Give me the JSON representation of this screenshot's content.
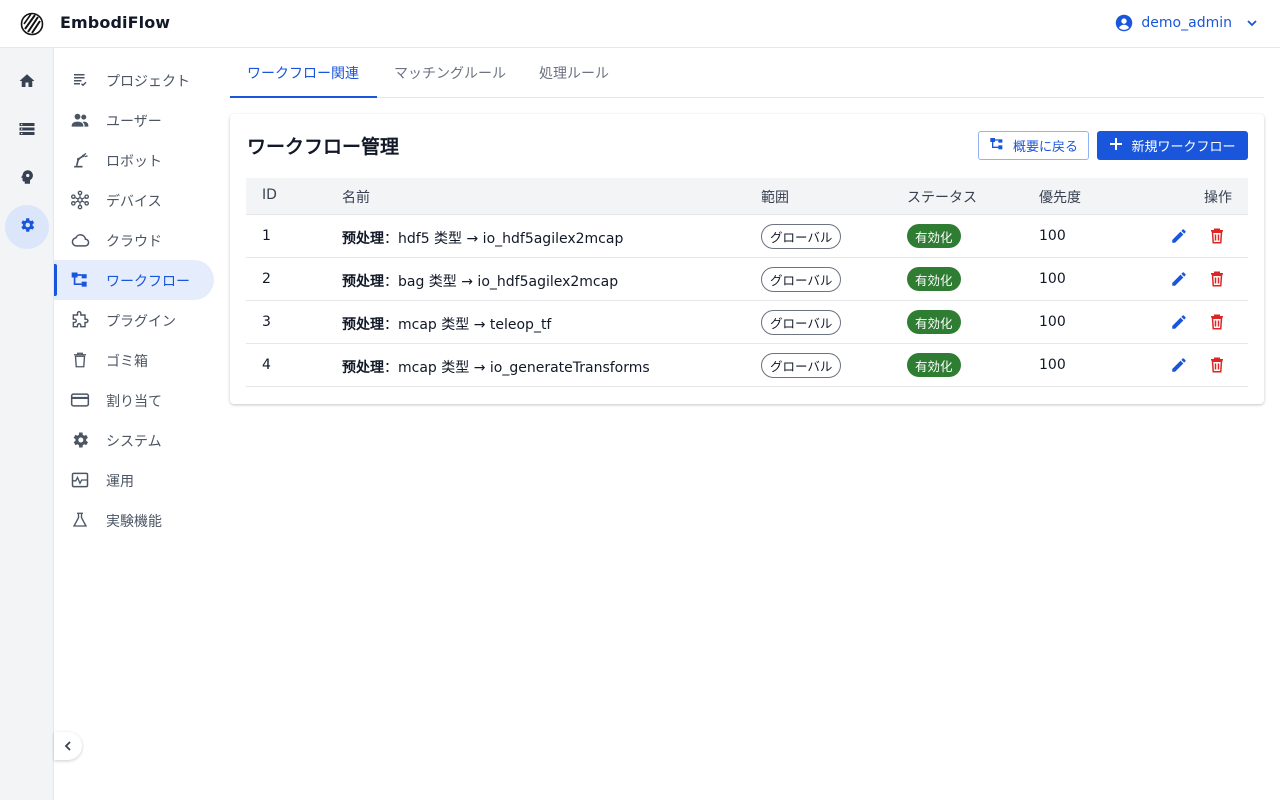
{
  "app": {
    "title": "EmbodiFlow"
  },
  "user": {
    "name": "demo_admin"
  },
  "rail": [
    {
      "icon": "home-icon",
      "active": false
    },
    {
      "icon": "storage-icon",
      "active": false
    },
    {
      "icon": "brain-icon",
      "active": false
    },
    {
      "icon": "gear-icon",
      "active": true
    }
  ],
  "sidebar": {
    "items": [
      {
        "label": "プロジェクト",
        "icon": "project-list-icon"
      },
      {
        "label": "ユーザー",
        "icon": "users-icon"
      },
      {
        "label": "ロボット",
        "icon": "robot-arm-icon"
      },
      {
        "label": "デバイス",
        "icon": "device-network-icon"
      },
      {
        "label": "クラウド",
        "icon": "cloud-icon"
      },
      {
        "label": "ワークフロー",
        "icon": "workflow-icon",
        "active": true
      },
      {
        "label": "プラグイン",
        "icon": "puzzle-icon"
      },
      {
        "label": "ゴミ箱",
        "icon": "trash-icon"
      },
      {
        "label": "割り当て",
        "icon": "credit-card-icon"
      },
      {
        "label": "システム",
        "icon": "gear-icon"
      },
      {
        "label": "運用",
        "icon": "monitoring-icon"
      },
      {
        "label": "実験機能",
        "icon": "flask-icon"
      }
    ]
  },
  "tabs": [
    {
      "label": "ワークフロー関連",
      "active": true
    },
    {
      "label": "マッチングルール",
      "active": false
    },
    {
      "label": "処理ルール",
      "active": false
    }
  ],
  "card": {
    "title": "ワークフロー管理",
    "back_button": "概要に戻る",
    "new_button": "新規ワークフロー"
  },
  "table": {
    "headers": {
      "id": "ID",
      "name": "名前",
      "scope": "範囲",
      "status": "ステータス",
      "priority": "優先度",
      "actions": "操作"
    },
    "rows": [
      {
        "id": "1",
        "prefix": "预处理",
        "name": "：hdf5 类型 → io_hdf5agilex2mcap",
        "scope": "グローバル",
        "status": "有効化",
        "priority": "100"
      },
      {
        "id": "2",
        "prefix": "预处理",
        "name": "：bag 类型 → io_hdf5agilex2mcap",
        "scope": "グローバル",
        "status": "有効化",
        "priority": "100"
      },
      {
        "id": "3",
        "prefix": "预处理",
        "name": "：mcap 类型 → teleop_tf",
        "scope": "グローバル",
        "status": "有効化",
        "priority": "100"
      },
      {
        "id": "4",
        "prefix": "预处理",
        "name": "：mcap 类型 → io_generateTransforms",
        "scope": "グローバル",
        "status": "有効化",
        "priority": "100"
      }
    ]
  },
  "colors": {
    "accent": "#1a56db",
    "success": "#2e7d32",
    "danger": "#dc2626",
    "rail_bg": "#f3f4f6"
  }
}
